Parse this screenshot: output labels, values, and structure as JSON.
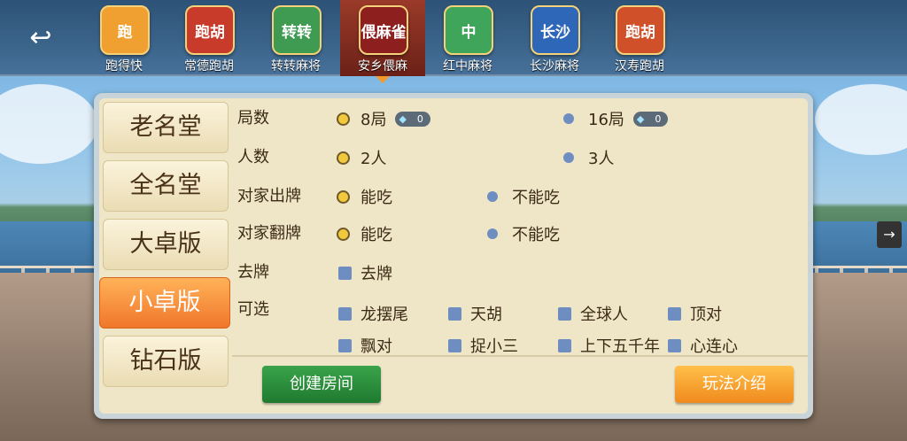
{
  "top_bar": {
    "back_icon": "back-arrow-icon",
    "games": [
      {
        "label": "跑得快",
        "icon": "paodekuai-icon",
        "color": "#f0a030",
        "text": "跑"
      },
      {
        "label": "常德跑胡",
        "icon": "changde-paohu-icon",
        "color": "#c83a2a",
        "text": "跑胡"
      },
      {
        "label": "转转麻将",
        "icon": "zhuanzhuan-mahjong-icon",
        "color": "#3f9a52",
        "text": "转转"
      },
      {
        "label": "安乡偎麻",
        "icon": "anxiang-weima-icon",
        "color": "#8e1f1f",
        "text": "偎麻雀"
      },
      {
        "label": "红中麻将",
        "icon": "hongzhong-mahjong-icon",
        "color": "#3fa55a",
        "text": "中"
      },
      {
        "label": "长沙麻将",
        "icon": "changsha-mahjong-icon",
        "color": "#2e66b8",
        "text": "长沙"
      },
      {
        "label": "汉寿跑胡",
        "icon": "hanshou-paohu-icon",
        "color": "#d0502a",
        "text": "跑胡"
      }
    ],
    "active_index": 3
  },
  "sidebar": {
    "items": [
      {
        "label": "老名堂"
      },
      {
        "label": "全名堂"
      },
      {
        "label": "大卓版"
      },
      {
        "label": "小卓版"
      },
      {
        "label": "钻石版"
      }
    ],
    "active_index": 3
  },
  "options": {
    "rounds": {
      "label": "局数",
      "a": "8局",
      "a_cost": "0",
      "b": "16局",
      "b_cost": "0"
    },
    "players": {
      "label": "人数",
      "a": "2人",
      "b": "3人"
    },
    "opponent_discard": {
      "label": "对家出牌",
      "a": "能吃",
      "b": "不能吃"
    },
    "opponent_flip": {
      "label": "对家翻牌",
      "a": "能吃",
      "b": "不能吃"
    },
    "remove_cards": {
      "label": "去牌",
      "a": "去牌"
    },
    "optional": {
      "label": "可选",
      "items": [
        "龙摆尾",
        "天胡",
        "全球人",
        "顶对",
        "飘对",
        "捉小三",
        "上下五千年",
        "心连心"
      ]
    }
  },
  "buttons": {
    "create_room": "创建房间",
    "rules": "玩法介绍"
  },
  "colors": {
    "active_tab": "#f0762b",
    "create_button": "#2e8f3d",
    "rules_button": "#f5a23a",
    "radio_selected": "#f2c93d",
    "radio_unselected": "#6e8ec2"
  }
}
